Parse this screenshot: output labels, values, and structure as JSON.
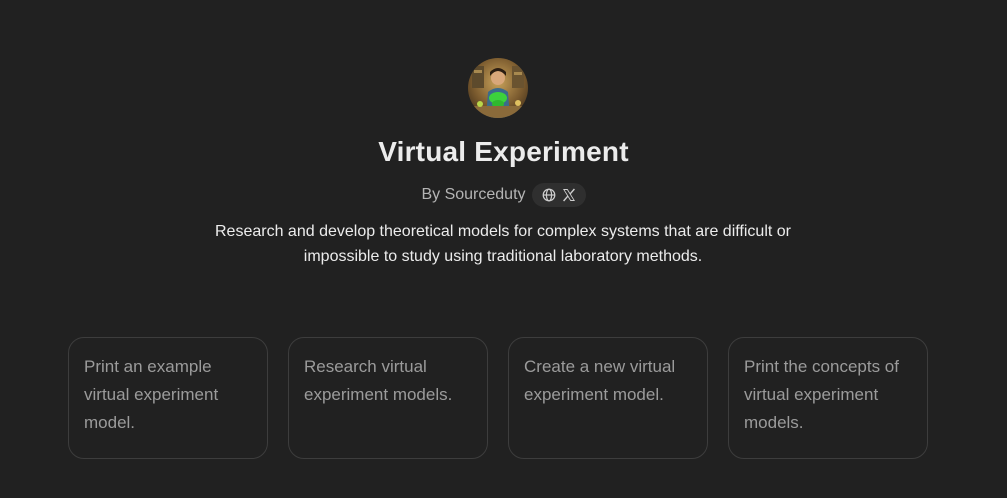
{
  "gpt": {
    "title": "Virtual Experiment",
    "author": "By Sourceduty",
    "description": "Research and develop theoretical models for complex systems that are difficult or impossible to study using traditional laboratory methods.",
    "social_icons": [
      "globe-icon",
      "x-logo-icon"
    ]
  },
  "starters": [
    {
      "label": "Print an example virtual experiment model."
    },
    {
      "label": "Research virtual experiment models."
    },
    {
      "label": "Create a new virtual experiment model."
    },
    {
      "label": "Print the concepts of virtual experiment models."
    }
  ],
  "colors": {
    "background": "#212121",
    "title": "#ececec",
    "muted": "#b4b4b4",
    "card_border": "#3d3d3d",
    "card_text": "#9b9b9b"
  }
}
